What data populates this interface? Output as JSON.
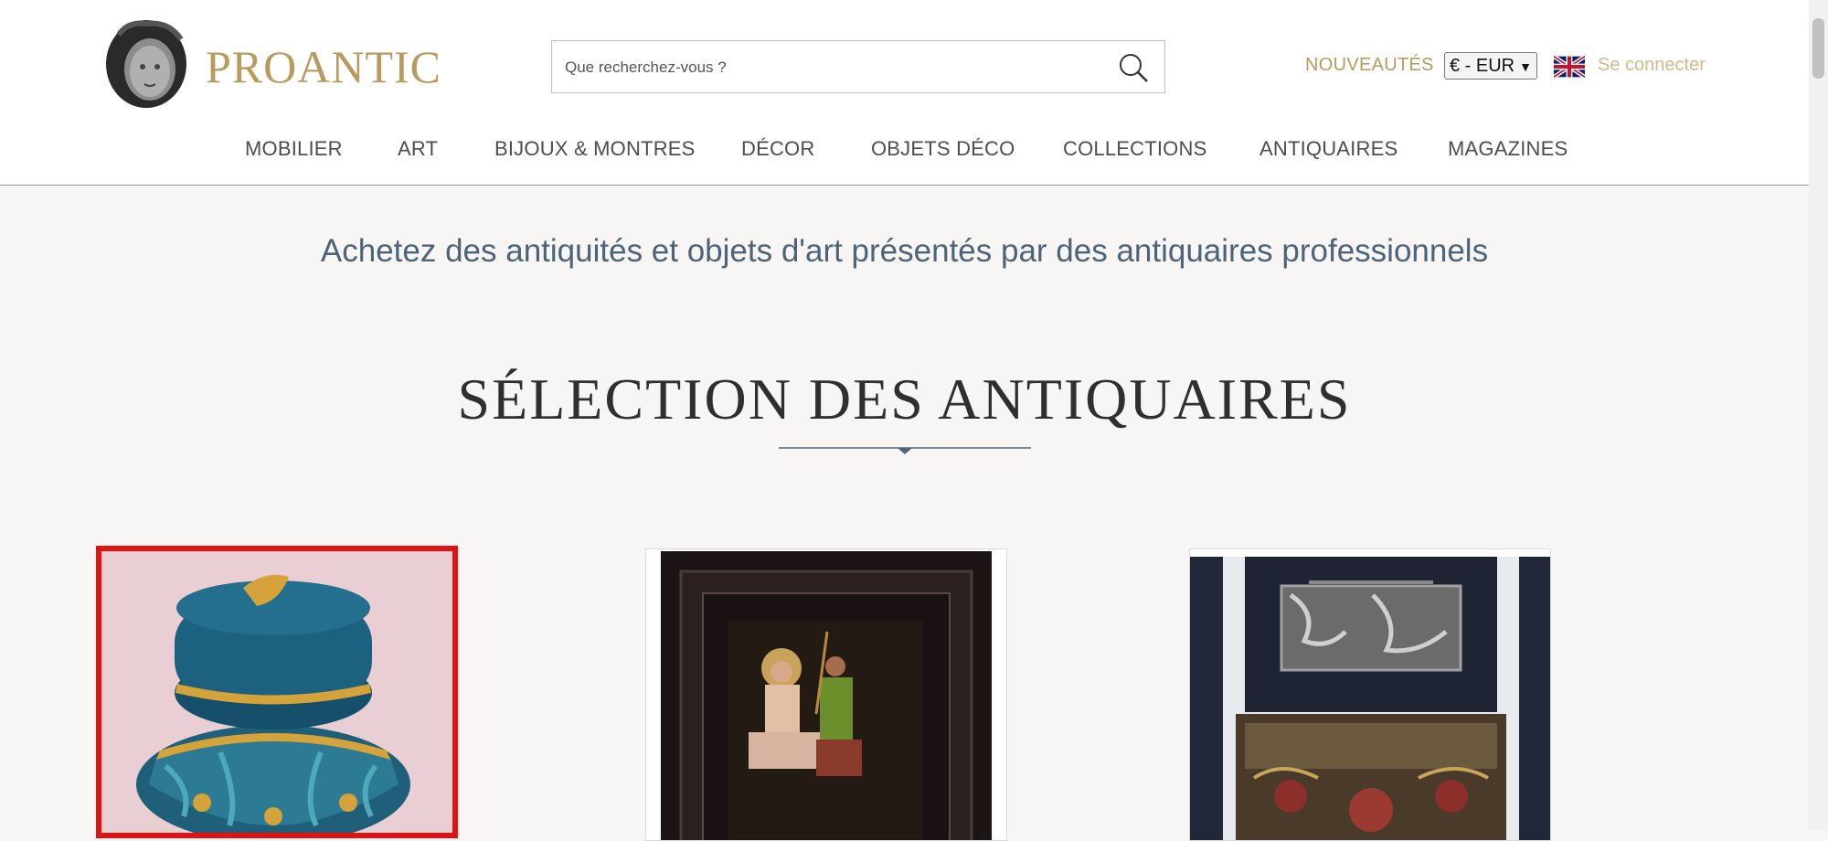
{
  "header": {
    "logo_text": "PROANTIC",
    "search": {
      "placeholder": "Que recherchez-vous ?"
    },
    "new_link": "NOUVEAUTÉS",
    "currency": {
      "selected": "€ - EUR"
    },
    "login": "Se connecter",
    "flag_icon": "uk-flag-icon"
  },
  "nav": {
    "items": [
      "MOBILIER",
      "ART",
      "BIJOUX & MONTRES",
      "DÉCOR",
      "OBJETS DÉCO",
      "COLLECTIONS",
      "ANTIQUAIRES",
      "MAGAZINES"
    ]
  },
  "main": {
    "tagline": "Achetez des antiquités et objets d'art présentés par des antiquaires professionnels",
    "section_title": "SÉLECTION DES ANTIQUAIRES",
    "cards": [
      {
        "subject": "blue and gold lidded glass jar",
        "selected": true
      },
      {
        "subject": "framed religious painting in ebonized frame",
        "selected": false
      },
      {
        "subject": "painted wooden chest with ornate metal lid",
        "selected": false
      }
    ]
  },
  "colors": {
    "accent_gold": "#b89a5e",
    "nav_text": "#4d4d4d",
    "tagline_blue": "#4d6378",
    "selection_red": "#e21212"
  }
}
